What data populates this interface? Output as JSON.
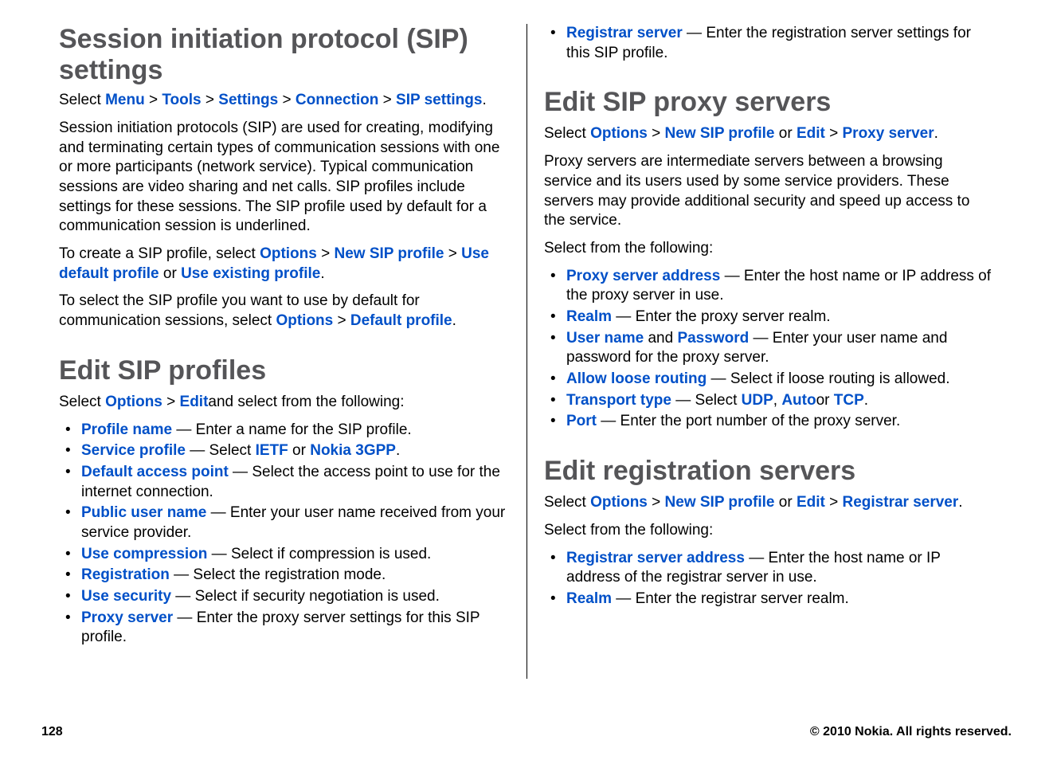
{
  "sections": {
    "sip_settings": {
      "title": "Session initiation protocol (SIP) settings",
      "breadcrumb_prefix": "Select ",
      "breadcrumb": [
        "Menu",
        "Tools",
        "Settings",
        "Connection",
        "SIP settings"
      ],
      "para1": "Session initiation protocols (SIP) are used for creating, modifying and terminating certain types of communication sessions with one or more participants (network service). Typical communication sessions are video sharing and net calls. SIP profiles include settings for these sessions. The SIP profile used by default for a communication session is underlined.",
      "para2_prefix": "To create a SIP profile, select ",
      "para2_links": {
        "options": "Options",
        "new": "New SIP profile",
        "use_default": "Use default profile",
        "use_existing": "Use existing profile"
      },
      "para2_or": " or ",
      "para3_prefix": "To select the SIP profile you want to use by default for communication sessions, select ",
      "para3_links": {
        "options": "Options",
        "default": "Default profile"
      }
    },
    "edit_profiles": {
      "title": "Edit SIP profiles",
      "select_prefix": "Select ",
      "select_links": {
        "options": "Options",
        "edit": "Edit"
      },
      "select_suffix": "and select from the following:",
      "items": [
        {
          "term": "Profile name",
          "desc": " — Enter a name for the SIP profile."
        },
        {
          "term": "Service profile",
          "desc_pre": " — Select ",
          "l1": "IETF",
          "mid": " or ",
          "l2": "Nokia 3GPP",
          "desc_post": "."
        },
        {
          "term": "Default access point",
          "desc": " — Select the access point to use for the internet connection."
        },
        {
          "term": "Public user name",
          "desc": " — Enter your user name received from your service provider."
        },
        {
          "term": "Use compression",
          "desc": " — Select if compression is used."
        },
        {
          "term": "Registration",
          "desc": " — Select the registration mode."
        },
        {
          "term": "Use security",
          "desc": " — Select if security negotiation is used."
        },
        {
          "term": "Proxy server",
          "desc": " — Enter the proxy server settings for this SIP profile."
        },
        {
          "term": "Registrar server",
          "desc": " — Enter the registration server settings for this SIP profile."
        }
      ]
    },
    "proxy": {
      "title": "Edit SIP proxy servers",
      "select_prefix": "Select ",
      "links": {
        "options": "Options",
        "new": "New SIP profile",
        "or": " or ",
        "edit": "Edit",
        "proxy": "Proxy server"
      },
      "para": "Proxy servers are intermediate servers between a browsing service and its users used by some service providers. These servers may provide additional security and speed up access to the service.",
      "select_from": "Select from the following:",
      "items": [
        {
          "term": "Proxy server address",
          "desc": " — Enter the host name or IP address of the proxy server in use."
        },
        {
          "term": "Realm",
          "desc": " — Enter the proxy server realm."
        },
        {
          "term": "User name",
          "mid": " and ",
          "term2": "Password",
          "desc": " — Enter your user name and password for the proxy server."
        },
        {
          "term": "Allow loose routing",
          "desc": " — Select if loose routing is allowed."
        },
        {
          "term": "Transport type",
          "desc_pre": " — Select ",
          "l1": "UDP",
          "c1": ", ",
          "l2": "Auto",
          "c2": "or ",
          "l3": "TCP",
          "desc_post": "."
        },
        {
          "term": "Port",
          "desc": " — Enter the port number of the proxy server."
        }
      ]
    },
    "registration": {
      "title": "Edit registration servers",
      "select_prefix": "Select ",
      "links": {
        "options": "Options",
        "new": "New SIP profile",
        "or": " or ",
        "edit": "Edit",
        "reg": "Registrar server"
      },
      "select_from": "Select from the following:",
      "items": [
        {
          "term": "Registrar server address",
          "desc": " — Enter the host name or IP address of the registrar server in use."
        },
        {
          "term": "Realm",
          "desc": " — Enter the registrar server realm."
        }
      ]
    }
  },
  "footer": {
    "page": "128",
    "copyright": "© 2010 Nokia. All rights reserved."
  },
  "separator": " > "
}
